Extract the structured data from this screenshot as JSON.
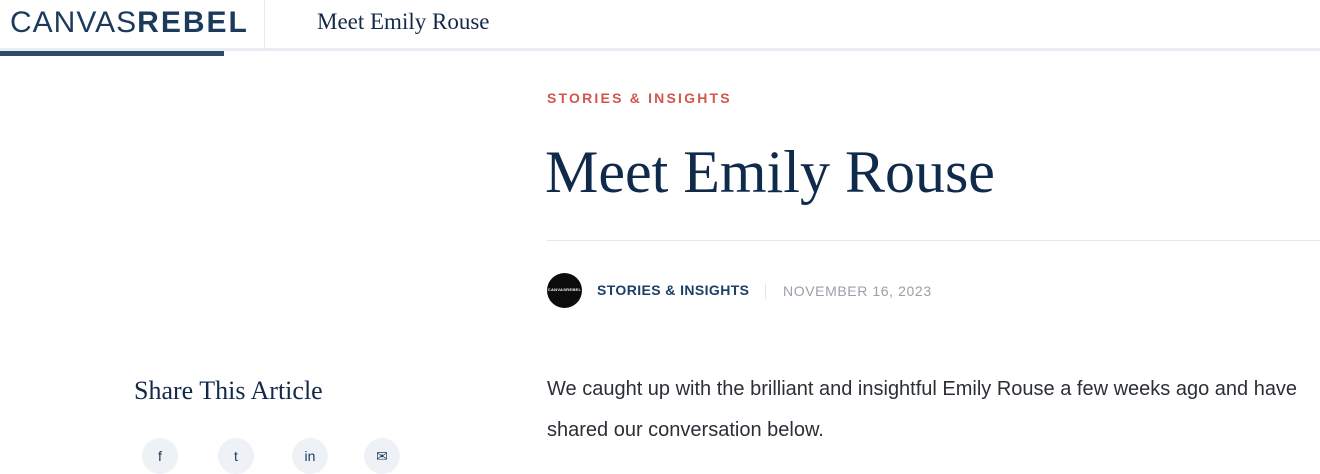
{
  "header": {
    "brand_light": "CANVAS",
    "brand_bold": "REBEL",
    "page_title": "Meet Emily Rouse"
  },
  "article": {
    "category": "STORIES & INSIGHTS",
    "headline": "Meet Emily Rouse",
    "author": "STORIES & INSIGHTS",
    "avatar_text": "CANVASREBEL",
    "date": "NOVEMBER 16, 2023",
    "intro": "We caught up with the brilliant and insightful Emily Rouse a few weeks ago and have shared our conversation below."
  },
  "sidebar": {
    "share_title": "Share This Article",
    "share_buttons": [
      {
        "icon": "facebook-icon",
        "glyph": "f"
      },
      {
        "icon": "twitter-icon",
        "glyph": "t"
      },
      {
        "icon": "linkedin-icon",
        "glyph": "in"
      },
      {
        "icon": "email-icon",
        "glyph": "✉"
      }
    ]
  },
  "colors": {
    "brand_navy": "#1b3a5c",
    "kicker_red": "#d2574a",
    "headline_navy": "#102a4c",
    "date_gray": "#9aa0a8"
  },
  "reading_progress": 0.17
}
